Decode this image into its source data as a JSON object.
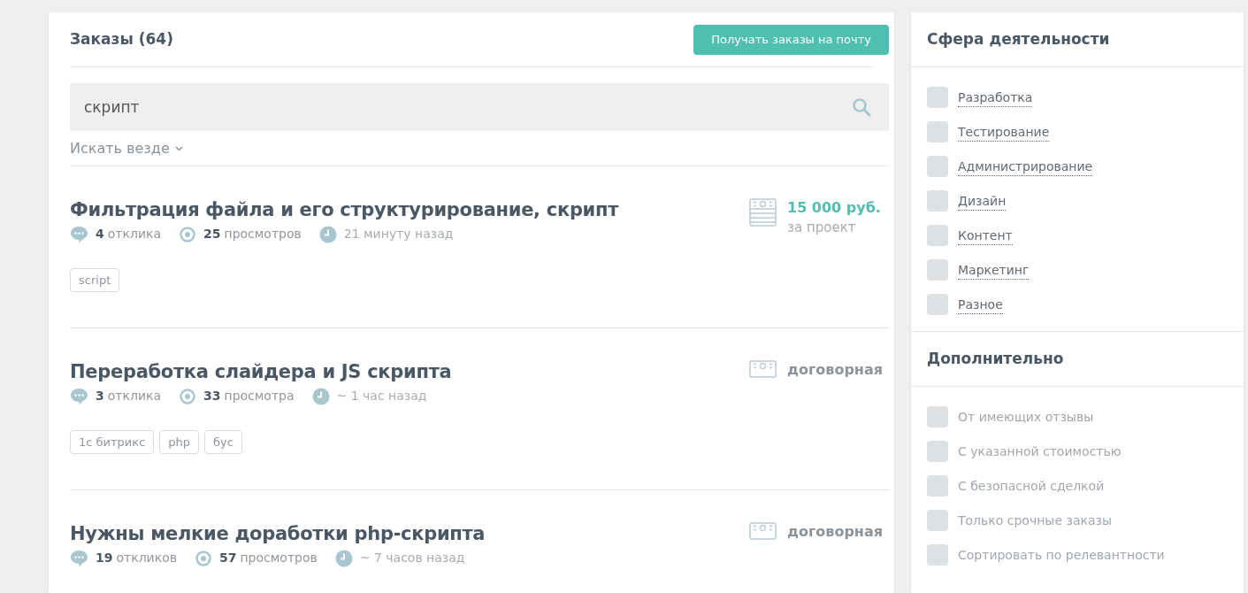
{
  "orders_panel": {
    "title": "Заказы (64)",
    "subscribe_button": "Получать заказы на почту",
    "search": {
      "value": "скрипт"
    },
    "search_scope": "Искать везде"
  },
  "orders": [
    {
      "title": "Фильтрация файла и его структурирование, скрипт",
      "responses_count": "4",
      "responses_label": "отклика",
      "views_count": "25",
      "views_label": "просмотров",
      "time": "21 минуту назад",
      "kind": "fixed",
      "price": "15 000 руб.",
      "price_note": "за проект",
      "tags": [
        "script"
      ]
    },
    {
      "title": "Переработка слайдера и JS скрипта",
      "responses_count": "3",
      "responses_label": "отклика",
      "views_count": "33",
      "views_label": "просмотра",
      "time": "~ 1 час назад",
      "kind": "negotiable",
      "price": "договорная",
      "tags": [
        "1с битрикс",
        "php",
        "бус"
      ]
    },
    {
      "title": "Нужны мелкие доработки php-скрипта",
      "responses_count": "19",
      "responses_label": "откликов",
      "views_count": "57",
      "views_label": "просмотров",
      "time": "~ 7 часов назад",
      "kind": "negotiable",
      "price": "договорная"
    }
  ],
  "sidebar": {
    "sections": [
      {
        "title": "Сфера деятельности",
        "kind": "category",
        "items": [
          {
            "label": "Разработка",
            "checked": false
          },
          {
            "label": "Тестирование",
            "checked": false
          },
          {
            "label": "Администрирование",
            "checked": false
          },
          {
            "label": "Дизайн",
            "checked": false
          },
          {
            "label": "Контент",
            "checked": false
          },
          {
            "label": "Маркетинг",
            "checked": false
          },
          {
            "label": "Разное",
            "checked": false
          }
        ]
      },
      {
        "title": "Дополнительно",
        "kind": "option",
        "items": [
          {
            "label": "От имеющих отзывы",
            "checked": false
          },
          {
            "label": "С указанной стоимостью",
            "checked": false
          },
          {
            "label": "С безопасной сделкой",
            "checked": false
          },
          {
            "label": "Только срочные заказы",
            "checked": false
          },
          {
            "label": "Сортировать по релевантности",
            "checked": false
          }
        ]
      }
    ]
  }
}
